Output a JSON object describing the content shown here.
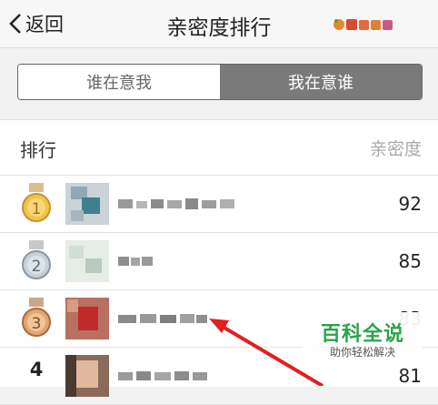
{
  "header": {
    "back_label": "返回",
    "title": "亲密度排行"
  },
  "tabs": [
    {
      "label": "谁在意我",
      "active": false
    },
    {
      "label": "我在意谁",
      "active": true
    }
  ],
  "list_header": {
    "rank": "排行",
    "intimacy": "亲密度"
  },
  "rows": [
    {
      "rank": "1",
      "medal": "gold",
      "score": "92"
    },
    {
      "rank": "2",
      "medal": "silver",
      "score": "85"
    },
    {
      "rank": "3",
      "medal": "bronze",
      "score": "83"
    },
    {
      "rank": "4",
      "medal": "none",
      "score": "81"
    }
  ],
  "watermark": {
    "main": "百科全说",
    "sub": "助你轻松解决"
  },
  "colors": {
    "active_tab": "#7a7a7a",
    "watermark_green": "#2aa34a",
    "arrow_red": "#e02020"
  }
}
